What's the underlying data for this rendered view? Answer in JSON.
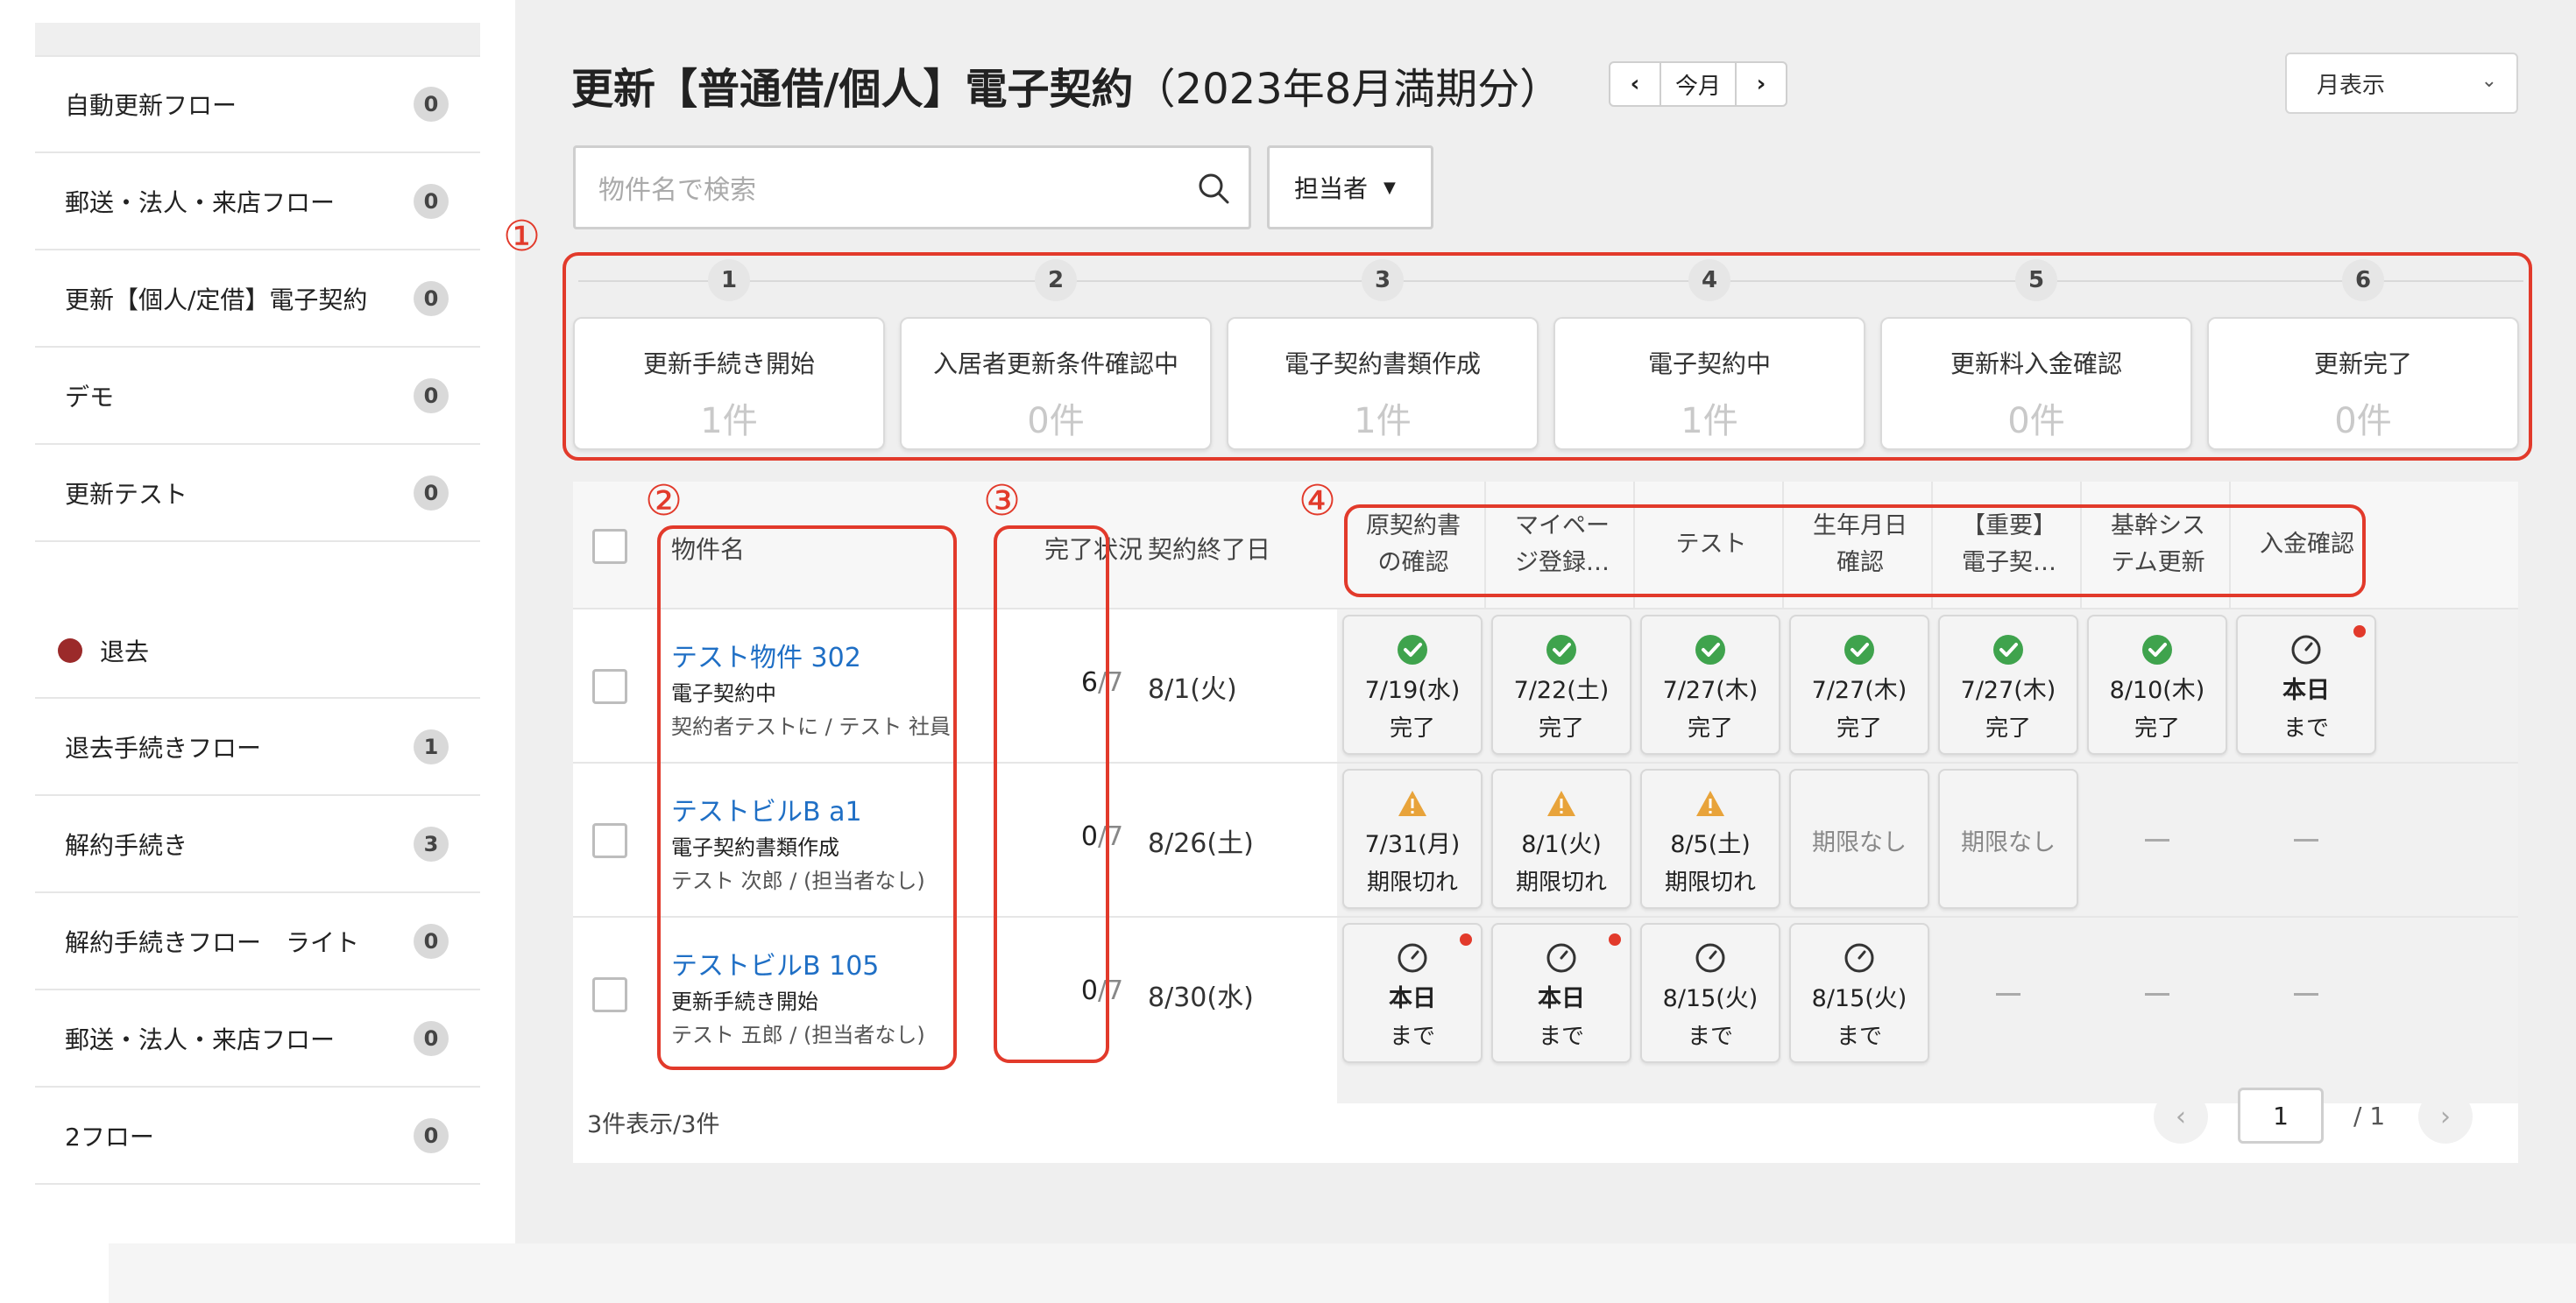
{
  "sidebar": {
    "items": [
      {
        "label": "自動更新フロー",
        "count": "0"
      },
      {
        "label": "郵送・法人・来店フロー",
        "count": "0"
      },
      {
        "label": "更新【個人/定借】電子契約",
        "count": "0"
      },
      {
        "label": "デモ",
        "count": "0"
      },
      {
        "label": "更新テスト",
        "count": "0"
      }
    ],
    "section": {
      "label": "退去",
      "color": "#9b2a2a"
    },
    "items2": [
      {
        "label": "退去手続きフロー",
        "count": "1"
      },
      {
        "label": "解約手続き",
        "count": "3"
      },
      {
        "label": "解約手続きフロー　ライト",
        "count": "0"
      },
      {
        "label": "郵送・法人・来店フロー",
        "count": "0"
      },
      {
        "label": "2フロー",
        "count": "0"
      }
    ]
  },
  "header": {
    "title": "更新【普通借/個人】電子契約",
    "period": "（2023年8月満期分）",
    "prev": "‹",
    "current": "今月",
    "next": "›",
    "view": "月表示"
  },
  "search": {
    "placeholder": "物件名で検索"
  },
  "assignee": {
    "label": "担当者"
  },
  "annotations": {
    "a1": "①",
    "a2": "②",
    "a3": "③",
    "a4": "④"
  },
  "steps": [
    {
      "num": "1",
      "label": "更新手続き開始",
      "count": "1件"
    },
    {
      "num": "2",
      "label": "入居者更新条件確認中",
      "count": "0件"
    },
    {
      "num": "3",
      "label": "電子契約書類作成",
      "count": "1件"
    },
    {
      "num": "4",
      "label": "電子契約中",
      "count": "1件"
    },
    {
      "num": "5",
      "label": "更新料入金確認",
      "count": "0件"
    },
    {
      "num": "6",
      "label": "更新完了",
      "count": "0件"
    }
  ],
  "table": {
    "headers": {
      "name": "物件名",
      "done": "完了状況",
      "end": "契約終了日",
      "tasks": [
        [
          "原契約書",
          "の確認"
        ],
        [
          "マイペー",
          "ジ登録…"
        ],
        [
          "テスト",
          ""
        ],
        [
          "生年月日",
          "確認"
        ],
        [
          "【重要】",
          "電子契…"
        ],
        [
          "基幹シス",
          "テム更新"
        ],
        [
          "入金確認",
          ""
        ]
      ]
    },
    "rows": [
      {
        "name": "テスト物件 302",
        "status": "電子契約中",
        "sub": "契約者テストに / テスト 社員",
        "done": "6",
        "total": "/7",
        "end": "8/1(火)",
        "cells": [
          {
            "kind": "check",
            "l1": "7/19(水)",
            "l2": "完了"
          },
          {
            "kind": "check",
            "l1": "7/22(土)",
            "l2": "完了"
          },
          {
            "kind": "check",
            "l1": "7/27(木)",
            "l2": "完了"
          },
          {
            "kind": "check",
            "l1": "7/27(木)",
            "l2": "完了"
          },
          {
            "kind": "check",
            "l1": "7/27(木)",
            "l2": "完了"
          },
          {
            "kind": "check",
            "l1": "8/10(木)",
            "l2": "完了"
          },
          {
            "kind": "clock",
            "l1": "本日",
            "l2": "まで",
            "dot": true
          }
        ]
      },
      {
        "name": "テストビルB a1",
        "status": "電子契約書類作成",
        "sub": "テスト 次郎 / (担当者なし)",
        "done": "0",
        "total": "/7",
        "end": "8/26(土)",
        "cells": [
          {
            "kind": "warn",
            "l1": "7/31(月)",
            "l2": "期限切れ"
          },
          {
            "kind": "warn",
            "l1": "8/1(火)",
            "l2": "期限切れ"
          },
          {
            "kind": "warn",
            "l1": "8/5(土)",
            "l2": "期限切れ"
          },
          {
            "kind": "none",
            "l1": "期限なし"
          },
          {
            "kind": "none",
            "l1": "期限なし"
          },
          {
            "kind": "dash"
          },
          {
            "kind": "dash"
          }
        ]
      },
      {
        "name": "テストビルB 105",
        "status": "更新手続き開始",
        "sub": "テスト 五郎 / (担当者なし)",
        "done": "0",
        "total": "/7",
        "end": "8/30(水)",
        "cells": [
          {
            "kind": "clock",
            "l1": "本日",
            "l2": "まで",
            "dot": true
          },
          {
            "kind": "clock",
            "l1": "本日",
            "l2": "まで",
            "dot": true
          },
          {
            "kind": "clock",
            "l1": "8/15(火)",
            "l2": "まで"
          },
          {
            "kind": "clock",
            "l1": "8/15(火)",
            "l2": "まで"
          },
          {
            "kind": "dash"
          },
          {
            "kind": "dash"
          },
          {
            "kind": "dash"
          }
        ]
      }
    ]
  },
  "footer": {
    "count": "3件表示/3件",
    "page": "1",
    "total": "/ 1",
    "prev": "‹",
    "next": "›"
  },
  "colors": {
    "accent_red": "#e23a2b",
    "link_blue": "#1f6fc5",
    "check_green": "#3fa34d",
    "warn_orange": "#e8a33a"
  }
}
